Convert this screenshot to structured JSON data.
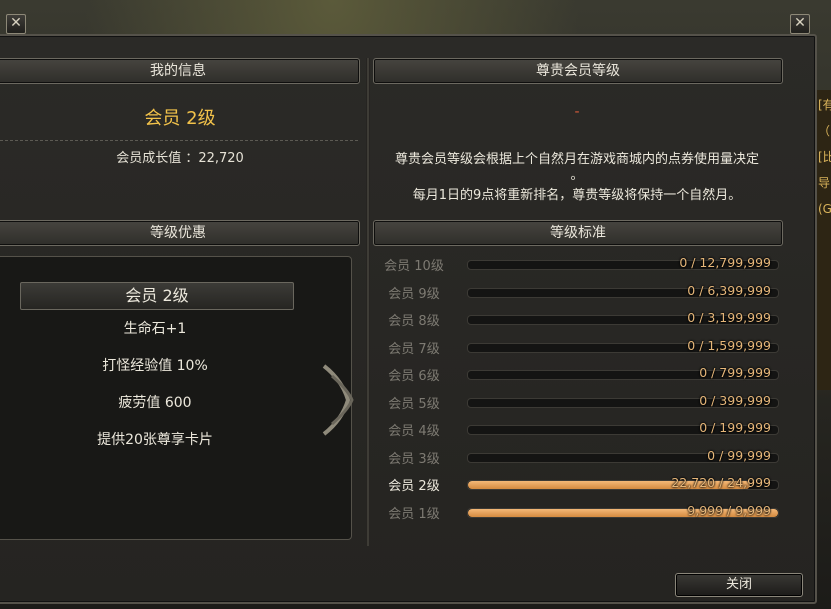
{
  "window": {
    "close_icon": "close-x-icon"
  },
  "left_panel": {
    "info_header": "我的信息",
    "level_title": "会员 2级",
    "growth_label": "会员成长值 ：22,720",
    "benefits_header": "等级优惠",
    "benefit_level": "会员 2级",
    "benefits": [
      "生命石+1",
      "打怪经验值 10%",
      "疲劳值 600",
      "提供20张尊享卡片"
    ]
  },
  "right_panel": {
    "level_header": "尊贵会员等级",
    "current_value": "-",
    "desc_line1": "尊贵会员等级会根据上个自然月在游戏商城内的点券使用量决定",
    "desc_line1b": "。",
    "desc_line2": "每月1日的9点将重新排名，尊贵等级将保持一个自然月。",
    "standard_header": "等级标准",
    "levels": [
      {
        "label": "会员 10级",
        "progress": "0 / 12,799,999",
        "fraction": 0
      },
      {
        "label": "会员 9级",
        "progress": "0 / 6,399,999",
        "fraction": 0
      },
      {
        "label": "会员 8级",
        "progress": "0 / 3,199,999",
        "fraction": 0
      },
      {
        "label": "会员 7级",
        "progress": "0 / 1,599,999",
        "fraction": 0
      },
      {
        "label": "会员 6级",
        "progress": "0 / 799,999",
        "fraction": 0
      },
      {
        "label": "会员 5级",
        "progress": "0 / 399,999",
        "fraction": 0
      },
      {
        "label": "会员 4级",
        "progress": "0 / 199,999",
        "fraction": 0
      },
      {
        "label": "会员 3级",
        "progress": "0 / 99,999",
        "fraction": 0
      },
      {
        "label": "会员 2级",
        "progress": "22,720 / 24,999",
        "fraction": 0.909
      },
      {
        "label": "会员 1级",
        "progress": "9,999 / 9,999",
        "fraction": 1.0
      }
    ]
  },
  "footer": {
    "close_button": "关闭"
  },
  "side_peek": [
    "[有",
    "（",
    "[比",
    "导",
    "(G"
  ],
  "colors": {
    "accent_gold": "#f2c24a",
    "bar_fill": "#e8a35a",
    "dash_red": "#d65a3a"
  }
}
